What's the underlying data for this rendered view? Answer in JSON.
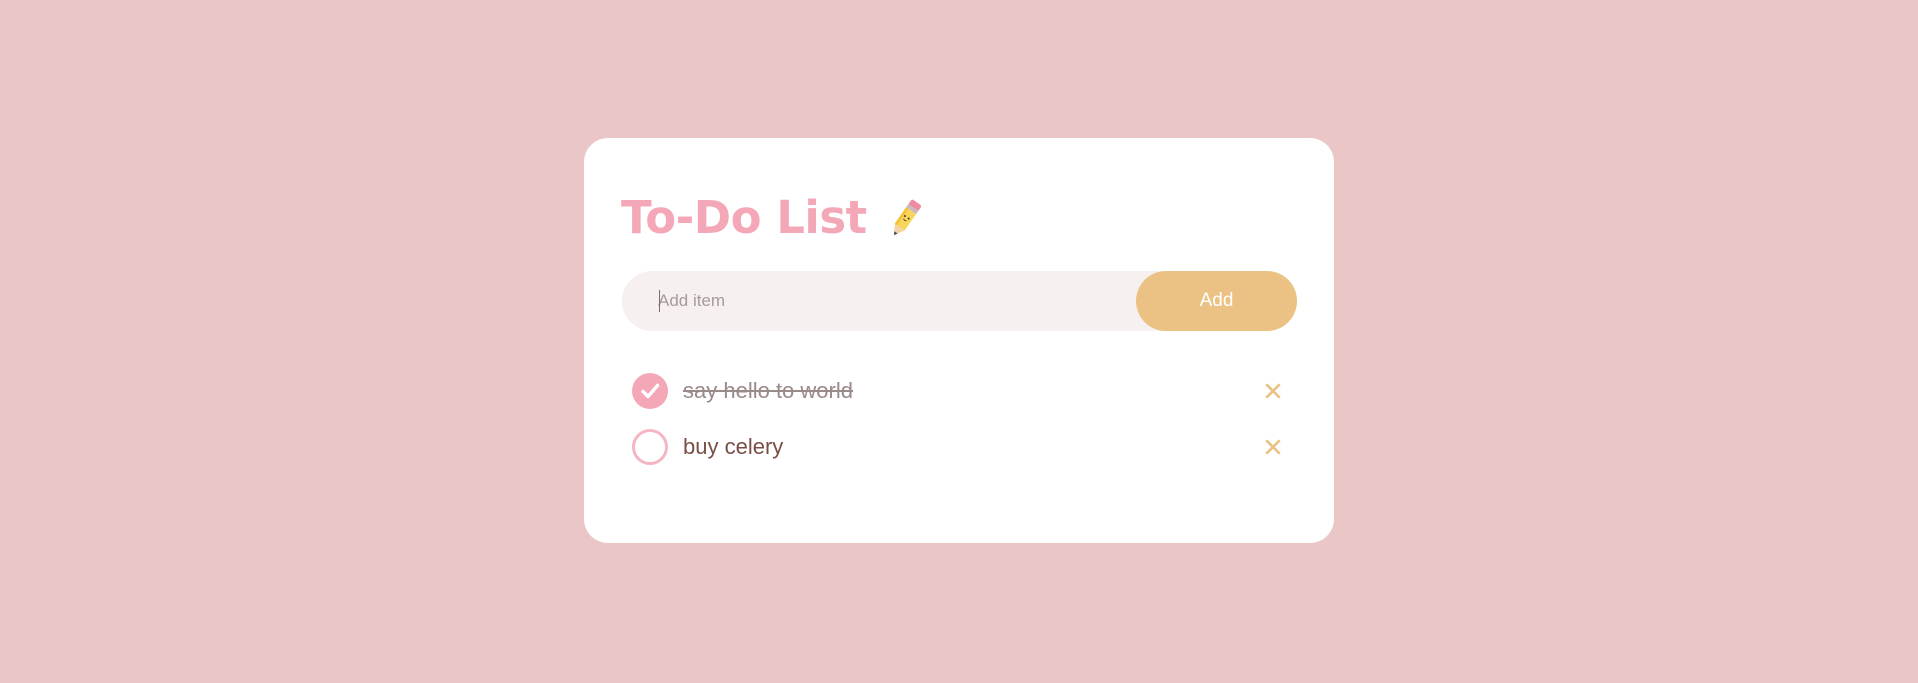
{
  "colors": {
    "page_background": "#ebc6c6",
    "card_background": "#ffffff",
    "accent_pink": "#f4a7b7",
    "accent_gold": "#ebc283",
    "text_brown": "#7a4e47"
  },
  "header": {
    "title": "To-Do List",
    "title_icon": "pencil-emoji-icon"
  },
  "add_form": {
    "input_value": "",
    "placeholder": "Add item",
    "button_label": "Add"
  },
  "todos": [
    {
      "text": "say hello to world",
      "completed": true,
      "check_icon": "checkmark-icon",
      "remove_icon": "close-icon"
    },
    {
      "text": "buy celery",
      "completed": false,
      "check_icon": "empty-circle-icon",
      "remove_icon": "close-icon"
    }
  ]
}
